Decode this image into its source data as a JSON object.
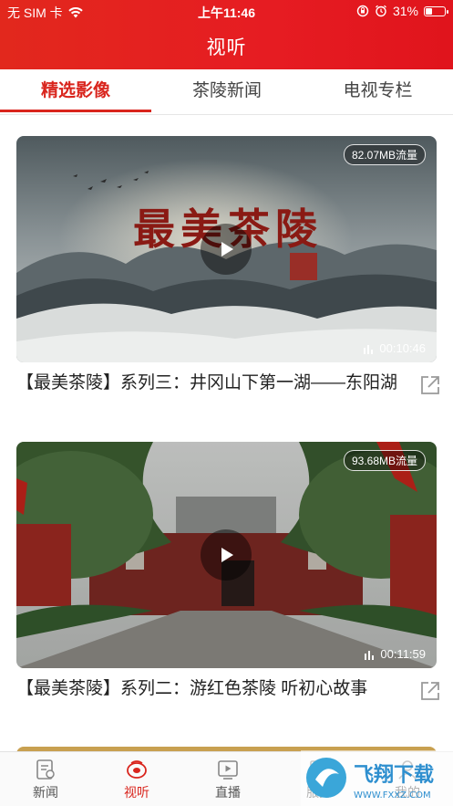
{
  "status_bar": {
    "carrier": "无 SIM 卡",
    "time": "上午11:46",
    "battery": "31%",
    "battery_level": 0.31
  },
  "header": {
    "title": "视听"
  },
  "tabs": [
    {
      "label": "精选影像",
      "active": true
    },
    {
      "label": "茶陵新闻",
      "active": false
    },
    {
      "label": "电视专栏",
      "active": false
    }
  ],
  "videos": [
    {
      "title": "【最美茶陵】系列三：井冈山下第一湖——东阳湖",
      "traffic": "82.07MB流量",
      "duration": "00:10:46",
      "cover_text": "最美茶陵"
    },
    {
      "title": "【最美茶陵】系列二：游红色茶陵 听初心故事",
      "traffic": "93.68MB流量",
      "duration": "00:11:59"
    }
  ],
  "bottom_nav": [
    {
      "label": "新闻",
      "icon": "news-icon"
    },
    {
      "label": "视听",
      "icon": "video-icon",
      "active": true
    },
    {
      "label": "直播",
      "icon": "live-icon"
    },
    {
      "label": "服务",
      "icon": "service-icon"
    },
    {
      "label": "我的",
      "icon": "profile-icon"
    }
  ],
  "watermark": {
    "text": "飞翔下载",
    "url_text": "WWW.FXXZ.COM"
  },
  "colors": {
    "brand_red": "#e61c22",
    "active_red": "#d9251d"
  }
}
